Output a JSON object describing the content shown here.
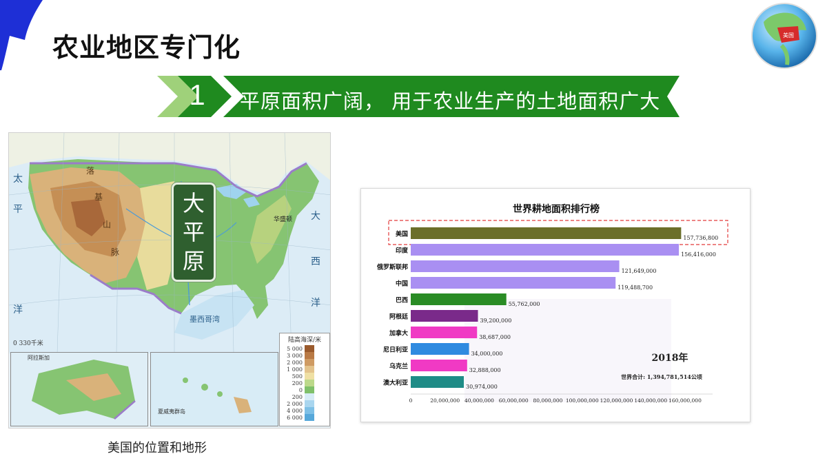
{
  "slide": {
    "title": "农业地区专门化",
    "banner_number": "1",
    "banner_text": "平原面积广阔， 用于农业生产的土地面积广大",
    "colors": {
      "banner_green": "#1f8a1f",
      "banner_light": "#9fd17a",
      "flag_blue": "#1e2fd6"
    }
  },
  "globe": {
    "label": "美国"
  },
  "map": {
    "plains_label": "大平原",
    "labels": [
      "太",
      "平",
      "洋",
      "大",
      "西",
      "洋",
      "落",
      "基",
      "山",
      "脉",
      "墨西哥湾",
      "华盛顿",
      "阿拉斯加",
      "夏威夷群岛"
    ],
    "scale_text": "0      330千米",
    "legend_title": "陆高海深/米",
    "legend": [
      {
        "value": "5 000",
        "color": "#9a5a2c"
      },
      {
        "value": "3 000",
        "color": "#b97a45"
      },
      {
        "value": "2 000",
        "color": "#cf9b63"
      },
      {
        "value": "1 000",
        "color": "#e3c38c"
      },
      {
        "value": "500",
        "color": "#efe0a4"
      },
      {
        "value": "200",
        "color": "#bcd98a"
      },
      {
        "value": "0",
        "color": "#7fc06a"
      },
      {
        "value": "200",
        "color": "#d6ecf6"
      },
      {
        "value": "2 000",
        "color": "#a9d6ef"
      },
      {
        "value": "4 000",
        "color": "#7ec0e6"
      },
      {
        "value": "6 000",
        "color": "#56a8da"
      }
    ],
    "caption": "美国的位置和地形"
  },
  "chart_data": {
    "type": "bar",
    "orientation": "horizontal",
    "title": "世界耕地面积排行榜",
    "categories": [
      "美国",
      "印度",
      "俄罗斯联邦",
      "中国",
      "巴西",
      "阿根廷",
      "加拿大",
      "尼日利亚",
      "乌克兰",
      "澳大利亚"
    ],
    "values": [
      157736800,
      156416000,
      121649000,
      119488700,
      55762000,
      39200000,
      38687000,
      34000000,
      32888000,
      30974000
    ],
    "value_labels": [
      "157,736,800",
      "156,416,000",
      "121,649,000",
      "119,488,700",
      "55,762,000",
      "39,200,000",
      "38,687,000",
      "34,000,000",
      "32,888,000",
      "30,974,000"
    ],
    "colors": [
      "#6b6f2a",
      "#a98ff2",
      "#a98ff2",
      "#a98ff2",
      "#2a8c25",
      "#7a2a8a",
      "#f03ac4",
      "#2f8be0",
      "#f03ac4",
      "#1f8c87"
    ],
    "x_ticks": [
      "0",
      "20,000,000",
      "40,000,000",
      "60,000,000",
      "80,000,000",
      "100,000,000",
      "120,000,000",
      "140,000,000",
      "160,000,000"
    ],
    "xlim": [
      0,
      160000000
    ],
    "year_label": "2018年",
    "total_label": "世界合计: 1,394,781,514公顷",
    "highlight": "美国"
  }
}
